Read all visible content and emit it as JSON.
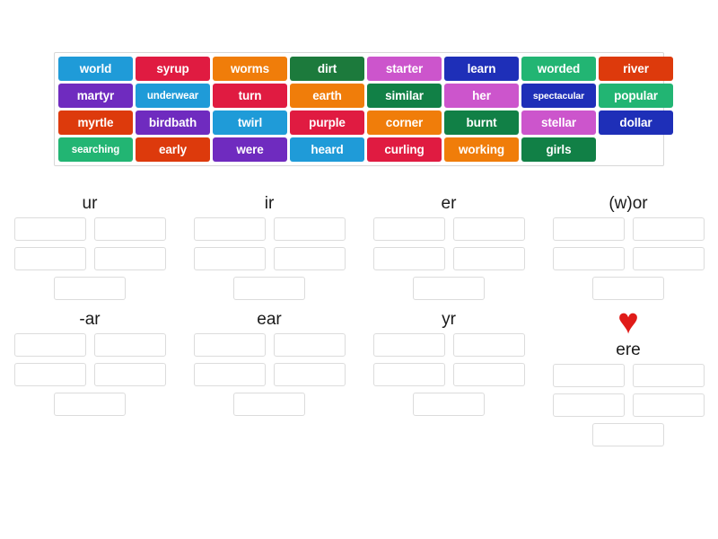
{
  "word_bank": {
    "rows": [
      [
        {
          "text": "world",
          "color": "#1f9bd8"
        },
        {
          "text": "syrup",
          "color": "#e01b41"
        },
        {
          "text": "worms",
          "color": "#f07d0a"
        },
        {
          "text": "dirt",
          "color": "#1c7a3c"
        },
        {
          "text": "starter",
          "color": "#cc55cc"
        },
        {
          "text": "learn",
          "color": "#1e2fb8"
        },
        {
          "text": "worded",
          "color": "#22b573"
        },
        {
          "text": "river",
          "color": "#dd3a0c"
        }
      ],
      [
        {
          "text": "martyr",
          "color": "#6f2bbf"
        },
        {
          "text": "underwear",
          "color": "#1f9bd8"
        },
        {
          "text": "turn",
          "color": "#e01b41"
        },
        {
          "text": "earth",
          "color": "#f07d0a"
        },
        {
          "text": "similar",
          "color": "#118046"
        },
        {
          "text": "her",
          "color": "#cc55cc"
        },
        {
          "text": "spectacular",
          "color": "#1e2fb8"
        },
        {
          "text": "popular",
          "color": "#22b573"
        }
      ],
      [
        {
          "text": "myrtle",
          "color": "#dd3a0c"
        },
        {
          "text": "birdbath",
          "color": "#6f2bbf"
        },
        {
          "text": "twirl",
          "color": "#1f9bd8"
        },
        {
          "text": "purple",
          "color": "#e01b41"
        },
        {
          "text": "corner",
          "color": "#f07d0a"
        },
        {
          "text": "burnt",
          "color": "#118046"
        },
        {
          "text": "stellar",
          "color": "#cc55cc"
        },
        {
          "text": "dollar",
          "color": "#1e2fb8"
        }
      ],
      [
        {
          "text": "searching",
          "color": "#22b573"
        },
        {
          "text": "early",
          "color": "#dd3a0c"
        },
        {
          "text": "were",
          "color": "#6f2bbf"
        },
        {
          "text": "heard",
          "color": "#1f9bd8"
        },
        {
          "text": "curling",
          "color": "#e01b41"
        },
        {
          "text": "working",
          "color": "#f07d0a"
        },
        {
          "text": "girls",
          "color": "#118046"
        },
        {
          "text": "",
          "color": "#ffffff",
          "blank": true
        }
      ]
    ]
  },
  "categories": {
    "row1": [
      {
        "title": "ur",
        "slots": 5
      },
      {
        "title": "ir",
        "slots": 5
      },
      {
        "title": "er",
        "slots": 5
      },
      {
        "title": "(w)or",
        "slots": 5
      }
    ],
    "row2": [
      {
        "title": "-ar",
        "slots": 5
      },
      {
        "title": "ear",
        "slots": 5
      },
      {
        "title": "yr",
        "slots": 5
      },
      {
        "title": "ere",
        "slots": 5,
        "icon": "heart-icon",
        "icon_glyph": "♥",
        "icon_color": "#e01b18"
      }
    ]
  }
}
